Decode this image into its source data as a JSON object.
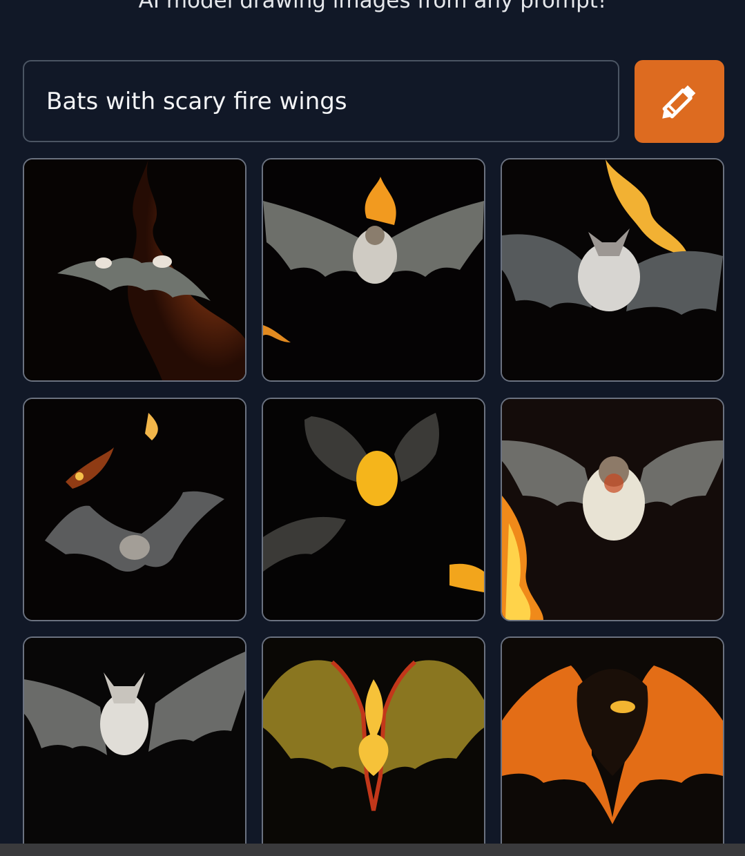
{
  "header": {
    "subtitle": "AI model drawing images from any prompt!"
  },
  "search": {
    "value": "Bats with scary fire wings"
  },
  "draw_button": {
    "icon": "pencil-icon",
    "color": "#dd6b20"
  },
  "colors": {
    "background": "#111827",
    "accent": "#dd6b20",
    "tile_border": "#6b7280"
  },
  "gallery": {
    "images": [
      {
        "icon": "bat-image"
      },
      {
        "icon": "bat-image"
      },
      {
        "icon": "bat-image"
      },
      {
        "icon": "bat-image"
      },
      {
        "icon": "bat-image"
      },
      {
        "icon": "bat-image"
      },
      {
        "icon": "bat-image"
      },
      {
        "icon": "bat-image"
      },
      {
        "icon": "bat-image"
      }
    ]
  }
}
